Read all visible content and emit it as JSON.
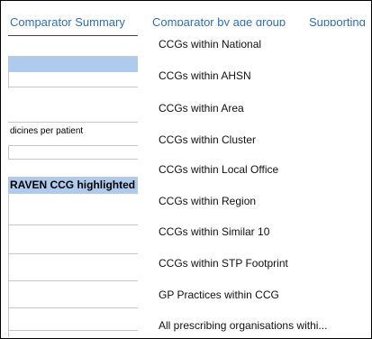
{
  "tabs": [
    {
      "label": "Comparator Summary"
    },
    {
      "label": "Comparator by age group"
    },
    {
      "label": "Supporting"
    }
  ],
  "sheet": {
    "row_label_medicines": "dicines per patient",
    "row_label_highlight": "RAVEN CCG highlighted"
  },
  "menu": {
    "items": [
      {
        "label": "CCGs within National"
      },
      {
        "label": "CCGs within AHSN"
      },
      {
        "label": "CCGs within Area"
      },
      {
        "label": "CCGs within Cluster"
      },
      {
        "label": "CCGs within Local Office"
      },
      {
        "label": "CCGs within Region"
      },
      {
        "label": "CCGs within Similar 10"
      },
      {
        "label": "CCGs within STP Footprint"
      },
      {
        "label": "GP Practices within CCG"
      },
      {
        "label": "All prescribing organisations withi..."
      }
    ]
  },
  "colors": {
    "tab_text": "#2d6fc4",
    "highlight_row": "#aecbee",
    "grid_line": "#c8c8c8"
  }
}
